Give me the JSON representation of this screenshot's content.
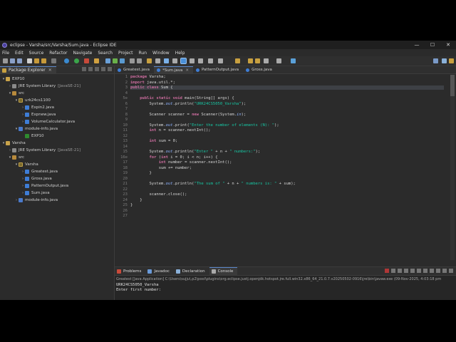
{
  "window": {
    "title": "eclipse - Varsha/src/Varsha/Sum.java - Eclipse IDE",
    "controls": [
      "—",
      "☐",
      "✕"
    ]
  },
  "menu": [
    "File",
    "Edit",
    "Source",
    "Refactor",
    "Navigate",
    "Search",
    "Project",
    "Run",
    "Window",
    "Help"
  ],
  "package_explorer": {
    "tab_label": "Package Explorer",
    "tree": [
      {
        "label": "EXP10",
        "extra": "",
        "icon": "project-icon",
        "arrow": "▾",
        "indent": 0
      },
      {
        "label": "JRE System Library",
        "extra": "[JavaSE-21]",
        "icon": "library-icon",
        "arrow": "›",
        "indent": 1
      },
      {
        "label": "src",
        "extra": "",
        "icon": "source-folder-icon",
        "arrow": "▾",
        "indent": 1
      },
      {
        "label": "urk24cs1100",
        "extra": "",
        "icon": "package-icon",
        "arrow": "▾",
        "indent": 2
      },
      {
        "label": "Expin2.java",
        "extra": "",
        "icon": "java-file-icon",
        "arrow": "›",
        "indent": 3
      },
      {
        "label": "Expnew.java",
        "extra": "",
        "icon": "java-file-icon",
        "arrow": "›",
        "indent": 3
      },
      {
        "label": "VolumeCalculator.java",
        "extra": "",
        "icon": "java-file-icon",
        "arrow": "›",
        "indent": 3
      },
      {
        "label": "module-info.java",
        "extra": "",
        "icon": "module-icon",
        "arrow": "▾",
        "indent": 2
      },
      {
        "label": "EXP10",
        "extra": "",
        "icon": "module-node-icon",
        "arrow": "",
        "indent": 3
      },
      {
        "label": "Varsha",
        "extra": "",
        "icon": "project-icon",
        "arrow": "▾",
        "indent": 0
      },
      {
        "label": "JRE System Library",
        "extra": "[JavaSE-21]",
        "icon": "library-icon",
        "arrow": "›",
        "indent": 1
      },
      {
        "label": "src",
        "extra": "",
        "icon": "source-folder-icon",
        "arrow": "▾",
        "indent": 1
      },
      {
        "label": "Varsha",
        "extra": "",
        "icon": "package-icon",
        "arrow": "▾",
        "indent": 2
      },
      {
        "label": "Greatest.java",
        "extra": "",
        "icon": "java-file-icon",
        "arrow": "›",
        "indent": 3
      },
      {
        "label": "Gross.java",
        "extra": "",
        "icon": "java-file-icon",
        "arrow": "›",
        "indent": 3
      },
      {
        "label": "PatternOutput.java",
        "extra": "",
        "icon": "java-file-icon",
        "arrow": "›",
        "indent": 3
      },
      {
        "label": "Sum.java",
        "extra": "",
        "icon": "java-file-icon",
        "arrow": "›",
        "indent": 3
      },
      {
        "label": "module-info.java",
        "extra": "",
        "icon": "module-icon",
        "arrow": "›",
        "indent": 2
      }
    ]
  },
  "editor": {
    "tabs": [
      {
        "label": "Greatest.java",
        "active": false
      },
      {
        "label": "*Sum.java",
        "active": true
      },
      {
        "label": "PatternOutput.java",
        "active": false
      },
      {
        "label": "Gross.java",
        "active": false
      }
    ],
    "lines": [
      {
        "n": "1",
        "html": "<span class=\"kw\">package</span> Varsha;"
      },
      {
        "n": "2",
        "html": "<span class=\"kw\">import</span> java.util.*;"
      },
      {
        "n": "3",
        "html": "<span class=\"kw\">public class</span> Sum {",
        "hl": true
      },
      {
        "n": "4",
        "html": ""
      },
      {
        "n": "5⊖",
        "html": "    <span class=\"kw\">public static void</span> main(String[] args) {"
      },
      {
        "n": "6",
        "html": "        System.<span class=\"fld\"><i>out</i></span>.println(<span class=\"str\">\"URK24CS5050_Varsha\"</span>);"
      },
      {
        "n": "7",
        "html": ""
      },
      {
        "n": "8",
        "html": "        Scanner scanner = <span class=\"kw\">new</span> Scanner(System.<span class=\"fld\"><i>in</i></span>);"
      },
      {
        "n": "9",
        "html": ""
      },
      {
        "n": "10",
        "html": "        System.<span class=\"fld\"><i>out</i></span>.print(<span class=\"str\">\"Enter the number of elements (N): \"</span>);"
      },
      {
        "n": "11",
        "html": "        <span class=\"kw\">int</span> n = scanner.nextInt();"
      },
      {
        "n": "12",
        "html": ""
      },
      {
        "n": "13",
        "html": "        <span class=\"kw\">int</span> sum = 0;"
      },
      {
        "n": "14",
        "html": ""
      },
      {
        "n": "15",
        "html": "        System.<span class=\"fld\"><i>out</i></span>.println(<span class=\"str\">\"Enter \"</span> + n + <span class=\"str\">\" numbers:\"</span>);"
      },
      {
        "n": "16⊖",
        "html": "        <span class=\"kw\">for</span> (<span class=\"kw\">int</span> i = 0; i &lt; n; i++) {"
      },
      {
        "n": "17",
        "html": "            <span class=\"kw\">int</span> number = scanner.nextInt();"
      },
      {
        "n": "18",
        "html": "            sum += number;"
      },
      {
        "n": "19",
        "html": "        }"
      },
      {
        "n": "20",
        "html": ""
      },
      {
        "n": "21",
        "html": "        System.<span class=\"fld\"><i>out</i></span>.println(<span class=\"str\">\"The sum of \"</span> + n + <span class=\"str\">\" numbers is: \"</span> + sum);"
      },
      {
        "n": "22",
        "html": ""
      },
      {
        "n": "23",
        "html": "        scanner.close();"
      },
      {
        "n": "24",
        "html": "    }"
      },
      {
        "n": "25",
        "html": "}"
      },
      {
        "n": "26",
        "html": ""
      },
      {
        "n": "27",
        "html": ""
      }
    ]
  },
  "bottom_panel": {
    "tabs": [
      {
        "label": "Problems",
        "active": false,
        "icon": "problems-icon"
      },
      {
        "label": "Javadoc",
        "active": false,
        "icon": "javadoc-icon"
      },
      {
        "label": "Declaration",
        "active": false,
        "icon": "declaration-icon"
      },
      {
        "label": "Console",
        "active": true,
        "icon": "console-icon"
      }
    ],
    "console_description": "Greatest [Java Application] C:\\Users\\sujju\\.p2\\pool\\plugins\\org.eclipse.justj.openjdk.hotspot.jre.full.win32.x86_64_21.0.7.v20250502-0916\\jre\\bin\\javaw.exe (09-Nov-2025, 4:03:18 pm",
    "console_output": [
      "URK24CS5050_Varsha",
      "Enter first number:"
    ]
  }
}
